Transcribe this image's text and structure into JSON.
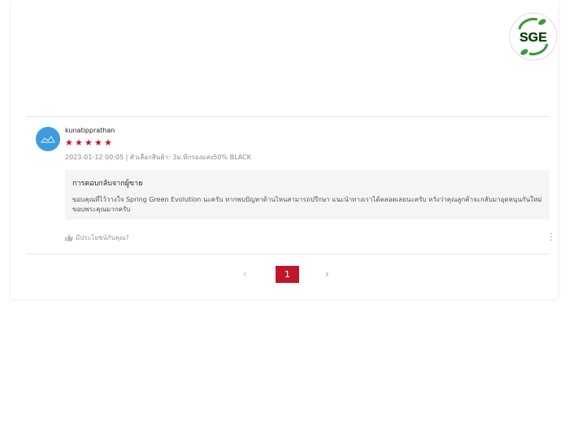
{
  "brand": {
    "logo_text": "SGE",
    "accent_color": "#c0172c",
    "logo_green": "#3a9a3a"
  },
  "review": {
    "username": "kunatipprathan",
    "rating": 5,
    "stars": [
      "★",
      "★",
      "★",
      "★",
      "★"
    ],
    "meta": "2023-01-12 00:05 | ตัวเลือกสินค้า: 3ม.ทีกรองแสง50% BLACK",
    "avatar_color": "#3d9be0",
    "seller_reply": {
      "title": "การตอบกลับจากผู้ขาย",
      "text": "ขอบคุณที่ไว้วางใจ Spring Green Evolution นะครับ หากพบปัญหาด้านไหนสามารถปรึกษา แนะนำทางเราได้ตลอดเลยนะครับ หวังว่าคุณลูกค้าจะกลับมาอุดหนุนกันใหม่ ขอบพระคุณมากครับ"
    },
    "helpful_label": "มีประโยชน์กับคุณ?",
    "helpful_icon": "thumbs-up-icon",
    "more_icon": "vertical-dots-icon"
  },
  "pagination": {
    "prev": "‹",
    "current": "1",
    "next": "›"
  }
}
